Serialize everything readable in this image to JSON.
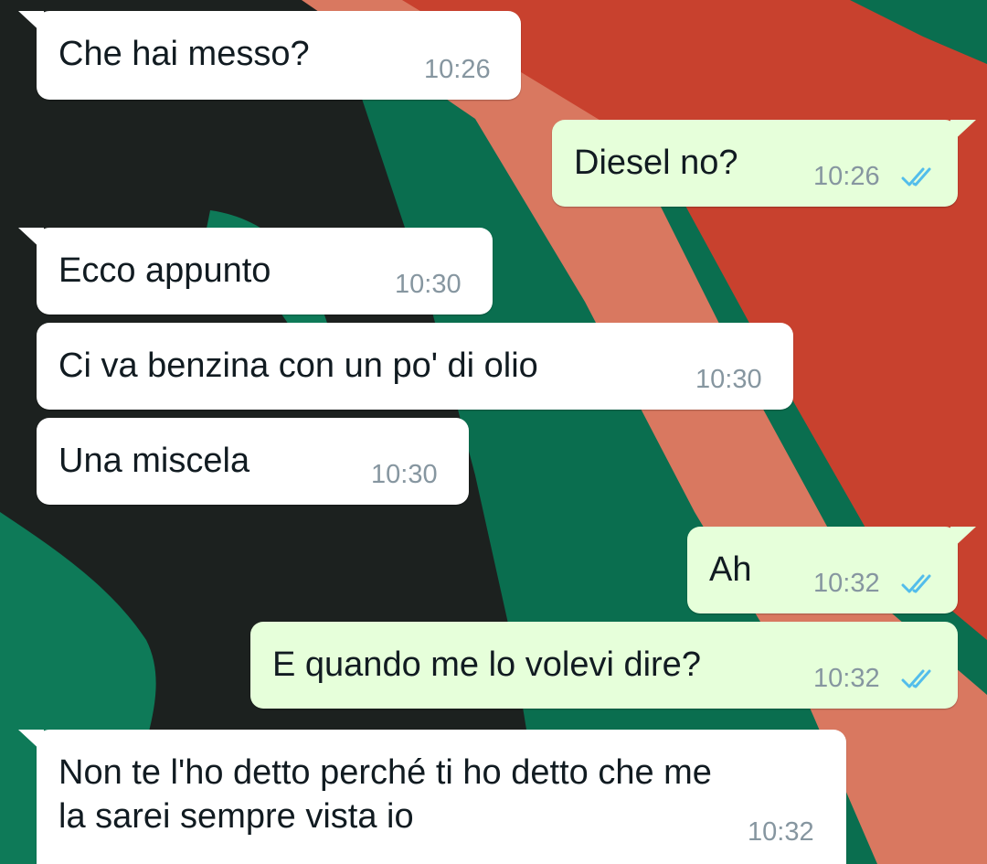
{
  "colors": {
    "incoming_bubble": "#ffffff",
    "outgoing_bubble": "#e6ffda",
    "text": "#111b21",
    "timestamp": "#8696a0",
    "read_ticks": "#53bdeb",
    "wallpaper_green": "#0a6e4f",
    "wallpaper_black": "#1c211f",
    "wallpaper_red": "#c8412e",
    "wallpaper_salmon": "#d97860"
  },
  "messages": [
    {
      "direction": "in",
      "text": "Che hai messo?",
      "time": "10:26"
    },
    {
      "direction": "out",
      "text": "Diesel no?",
      "time": "10:26",
      "status": "read"
    },
    {
      "direction": "in",
      "text": "Ecco appunto",
      "time": "10:30"
    },
    {
      "direction": "in",
      "text": "Ci va benzina con un po' di olio",
      "time": "10:30"
    },
    {
      "direction": "in",
      "text": "Una miscela",
      "time": "10:30"
    },
    {
      "direction": "out",
      "text": "Ah",
      "time": "10:32",
      "status": "read"
    },
    {
      "direction": "out",
      "text": "E quando me lo volevi dire?",
      "time": "10:32",
      "status": "read"
    },
    {
      "direction": "in",
      "text_lines": [
        "Non te l'ho detto perché ti ho detto che me",
        "la sarei sempre vista io"
      ],
      "time": "10:32"
    }
  ]
}
